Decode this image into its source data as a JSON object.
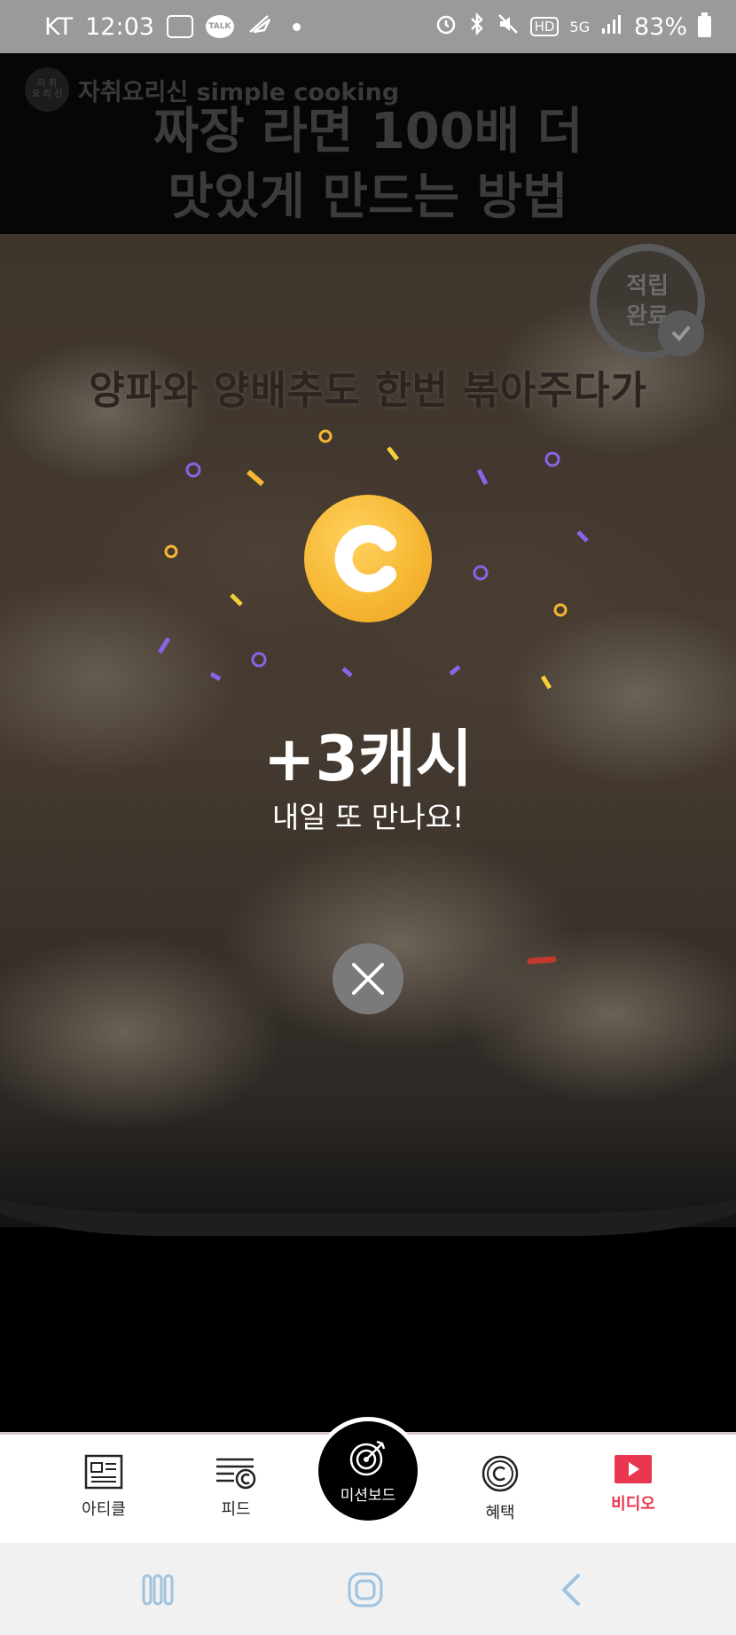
{
  "status_bar": {
    "carrier": "KT",
    "time": "12:03",
    "talk_label": "TALK",
    "network": "5G",
    "hd": "HD",
    "battery_percent": "83%"
  },
  "video": {
    "channel_name": "자취요리신 simple cooking",
    "channel_logo_text": "자 취\n요 리 신",
    "title_line1": "짜장 라면 100배 더",
    "title_line2": "맛있게 만드는 방법",
    "subtitle": "양파와 양배추도 한번 볶아주다가",
    "earned_badge": "적립\n완료"
  },
  "reward_popup": {
    "amount": "+3캐시",
    "message": "내일 또 만나요!",
    "coin_color": "#F6B632",
    "confetti_colors": [
      "#F6B632",
      "#8A63E8",
      "#F5D03A"
    ]
  },
  "bottom_nav": {
    "items": [
      {
        "label": "아티클",
        "icon": "article-icon"
      },
      {
        "label": "피드",
        "icon": "feed-icon"
      },
      {
        "label": "미션보드",
        "icon": "target-icon"
      },
      {
        "label": "혜택",
        "icon": "cash-c-icon"
      },
      {
        "label": "비디오",
        "icon": "play-icon"
      }
    ],
    "active_index": 4,
    "active_color": "#E8374E"
  },
  "system_nav": {
    "buttons": [
      "recent-apps",
      "home",
      "back"
    ]
  }
}
